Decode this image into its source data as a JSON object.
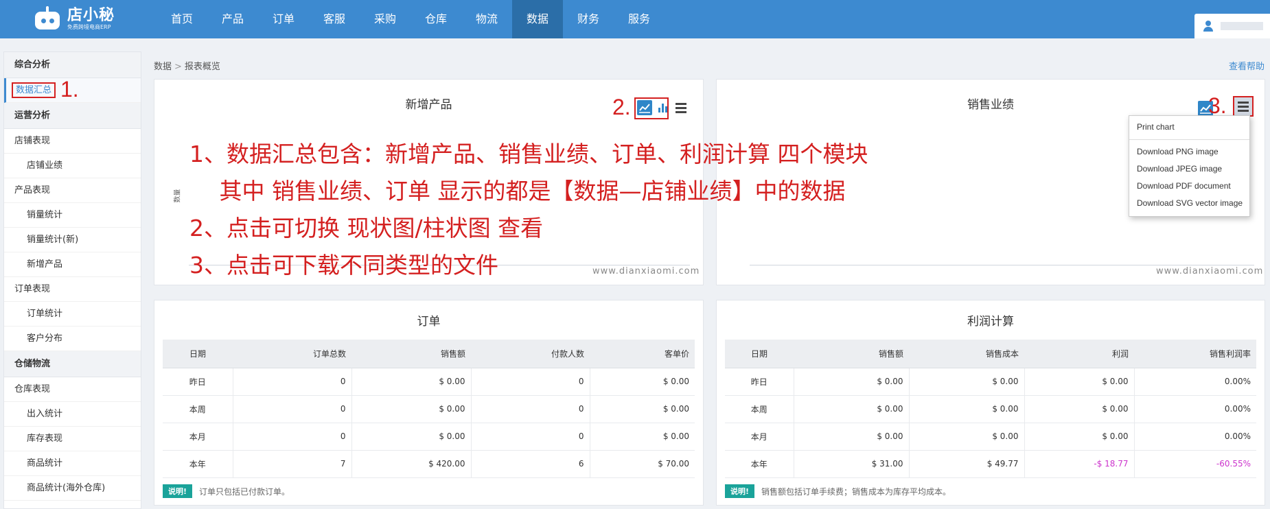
{
  "header": {
    "logo_title": "店小秘",
    "logo_subtitle": "免费跨境电商ERP",
    "nav": [
      "首页",
      "产品",
      "订单",
      "客服",
      "采购",
      "仓库",
      "物流",
      "数据",
      "财务",
      "服务"
    ],
    "active_nav": "数据"
  },
  "sidebar": {
    "items": [
      {
        "label": "综合分析",
        "kind": "group"
      },
      {
        "label": "数据汇总",
        "kind": "active"
      },
      {
        "label": "运营分析",
        "kind": "group"
      },
      {
        "label": "店铺表现",
        "kind": "item"
      },
      {
        "label": "店铺业绩",
        "kind": "sub"
      },
      {
        "label": "产品表现",
        "kind": "item"
      },
      {
        "label": "销量统计",
        "kind": "sub"
      },
      {
        "label": "销量统计(新)",
        "kind": "sub"
      },
      {
        "label": "新增产品",
        "kind": "sub"
      },
      {
        "label": "订单表现",
        "kind": "item"
      },
      {
        "label": "订单统计",
        "kind": "sub"
      },
      {
        "label": "客户分布",
        "kind": "sub"
      },
      {
        "label": "仓储物流",
        "kind": "group"
      },
      {
        "label": "仓库表现",
        "kind": "item"
      },
      {
        "label": "出入统计",
        "kind": "sub"
      },
      {
        "label": "库存表现",
        "kind": "sub"
      },
      {
        "label": "商品统计",
        "kind": "sub"
      },
      {
        "label": "商品统计(海外仓库)",
        "kind": "sub"
      }
    ]
  },
  "breadcrumb": {
    "root": "数据",
    "separator": ">",
    "current": "报表概览"
  },
  "help_link": "查看帮助",
  "panels": {
    "new_products": {
      "title": "新增产品",
      "y_label": "数量",
      "watermark": "www.dianxiaomi.com"
    },
    "sales": {
      "title": "销售业绩",
      "watermark": "www.dianxiaomi.com"
    },
    "orders": {
      "title": "订单",
      "headers": [
        "日期",
        "订单总数",
        "销售额",
        "付款人数",
        "客单价"
      ],
      "rows": [
        [
          "昨日",
          "0",
          "$ 0.00",
          "0",
          "$ 0.00"
        ],
        [
          "本周",
          "0",
          "$ 0.00",
          "0",
          "$ 0.00"
        ],
        [
          "本月",
          "0",
          "$ 0.00",
          "0",
          "$ 0.00"
        ],
        [
          "本年",
          "7",
          "$ 420.00",
          "6",
          "$ 70.00"
        ]
      ],
      "note_badge": "说明!",
      "note_text": "订单只包括已付款订单。"
    },
    "profit": {
      "title": "利润计算",
      "headers": [
        "日期",
        "销售额",
        "销售成本",
        "利润",
        "销售利润率"
      ],
      "rows": [
        [
          "昨日",
          "$ 0.00",
          "$ 0.00",
          "$ 0.00",
          "0.00%"
        ],
        [
          "本周",
          "$ 0.00",
          "$ 0.00",
          "$ 0.00",
          "0.00%"
        ],
        [
          "本月",
          "$ 0.00",
          "$ 0.00",
          "$ 0.00",
          "0.00%"
        ],
        [
          "本年",
          "$ 31.00",
          "$ 49.77",
          "-$ 18.77",
          "-60.55%"
        ]
      ],
      "note_badge": "说明!",
      "note_text": "销售额包括订单手续费；销售成本为库存平均成本。"
    }
  },
  "export_menu": [
    "Print chart",
    "Download PNG image",
    "Download JPEG image",
    "Download PDF document",
    "Download SVG vector image"
  ],
  "annotations": {
    "num1": "1.",
    "num2": "2.",
    "num3": "3.",
    "lines": [
      "1、数据汇总包含：新增产品、销售业绩、订单、利润计算 四个模块",
      "　 其中 销售业绩、订单 显示的都是【数据—店铺业绩】中的数据",
      "2、点击可切换 现状图/柱状图 查看",
      "3、点击可下载不同类型的文件"
    ]
  },
  "colors": {
    "nav_bg": "#3d8ad0",
    "nav_active": "#2b6ea8",
    "annotation": "#d42020",
    "negative": "#cc33cc",
    "badge": "#1aa39a"
  }
}
